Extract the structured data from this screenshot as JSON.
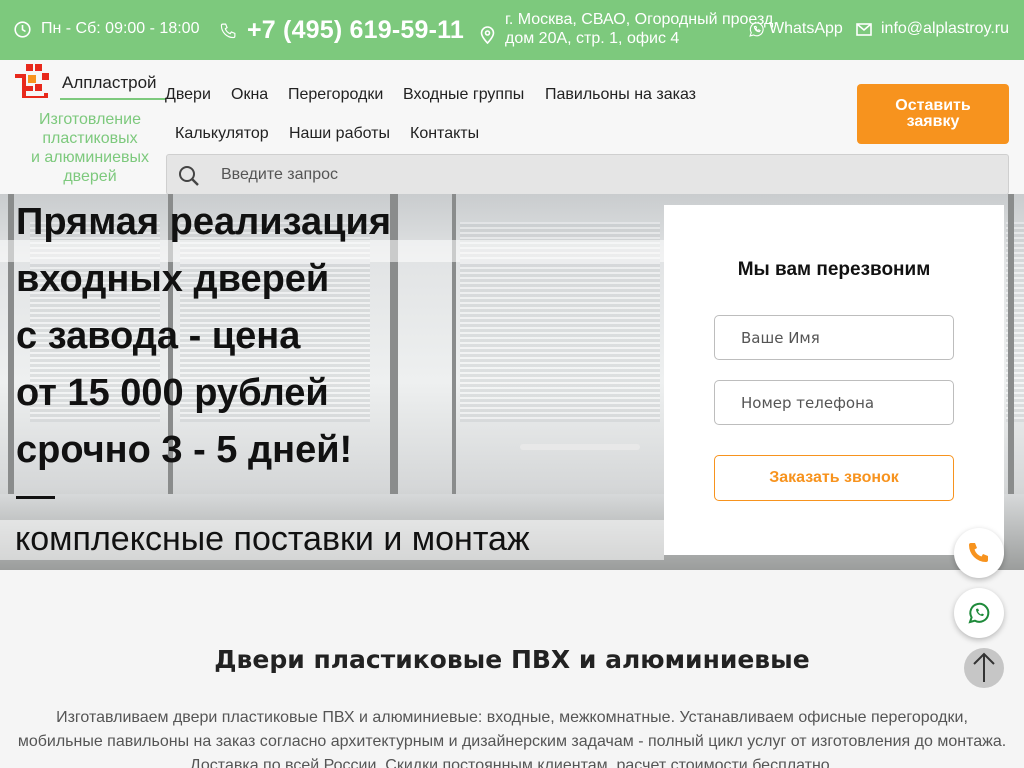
{
  "topbar": {
    "hours": "Пн - Сб: 09:00 - 18:00",
    "phone": "+7 (495) 619-59-11",
    "address_line1": "г. Москва, СВАО, Огородный проезд,",
    "address_line2": "дом 20А, стр. 1, офис 4",
    "whatsapp": "WhatsApp",
    "email": "info@alplastroy.ru",
    "icons": [
      "clock-icon",
      "phone-icon",
      "location-pin-icon",
      "whatsapp-icon",
      "mail-icon"
    ]
  },
  "header": {
    "logo_text": "Алпластрой",
    "tagline_lines": [
      "Изготовление",
      "пластиковых",
      "и алюминиевых",
      "дверей"
    ],
    "nav": [
      "Двери",
      "Окна",
      "Перегородки",
      "Входные группы",
      "Павильоны на заказ",
      "Калькулятор",
      "Наши работы",
      "Контакты"
    ],
    "cta_line1": "Оставить",
    "cta_line2": "заявку",
    "search_placeholder": "Введите запрос",
    "accent_color": "#7dc97d",
    "cta_color": "#f7931e"
  },
  "hero": {
    "title_lines": [
      "Прямая реализация",
      "входных дверей",
      "с завода - цена",
      "от 15 000 рублей",
      "срочно 3 - 5 дней!"
    ],
    "subtitle": "комплексные поставки и монтаж"
  },
  "callback_form": {
    "title": "Мы вам перезвоним",
    "name_placeholder": "Ваше Имя",
    "phone_placeholder": "Номер телефона",
    "submit_label": "Заказать звонок"
  },
  "floating": {
    "icons": [
      "phone-fab-icon",
      "whatsapp-fab-icon",
      "scroll-up-icon"
    ]
  },
  "content": {
    "title": "Двери пластиковые ПВХ и алюминиевые",
    "text_lines": [
      "Изготавливаем двери пластиковые ПВХ и алюминиевые: входные, межкомнатные. Устанавливаем офисные перегородки,",
      "мобильные павильоны на заказ согласно архитектурным и дизайнерским задачам - полный цикл услуг от изготовления до монтажа.",
      "Доставка по всей России. Скидки постоянным клиентам, расчет стоимости бесплатно."
    ]
  }
}
